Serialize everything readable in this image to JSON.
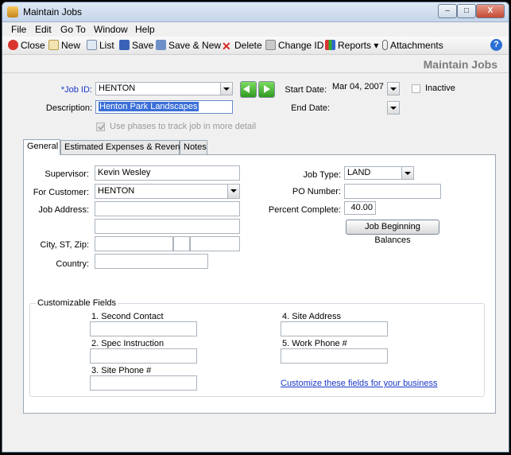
{
  "window": {
    "title": "Maintain Jobs",
    "minimize": "–",
    "maximize": "□",
    "close": "X"
  },
  "menu": [
    "File",
    "Edit",
    "Go To",
    "Window",
    "Help"
  ],
  "toolbar": {
    "close": "Close",
    "new": "New",
    "list": "List",
    "save": "Save",
    "save_new": "Save & New",
    "delete": "Delete",
    "change_id": "Change ID",
    "reports": "Reports ▾",
    "attachments": "Attachments",
    "help": "?"
  },
  "header": {
    "title": "Maintain Jobs"
  },
  "form": {
    "job_id_label": "*Job ID:",
    "job_id": "HENTON",
    "description_label": "Description:",
    "description": "Henton Park Landscapes",
    "start_date_label": "Start Date:",
    "start_date": "Mar 04, 2007",
    "end_date_label": "End Date:",
    "end_date": "",
    "inactive_label": "Inactive",
    "phases_label": "Use phases to track job in more detail"
  },
  "tabs": [
    "General",
    "Estimated Expenses & Revenue",
    "Notes"
  ],
  "general": {
    "supervisor_label": "Supervisor:",
    "supervisor": "Kevin Wesley",
    "customer_label": "For Customer:",
    "customer": "HENTON",
    "address_label": "Job Address:",
    "address1": "",
    "address2": "",
    "city_label": "City, ST, Zip:",
    "city": "",
    "state": "",
    "zip": "",
    "country_label": "Country:",
    "country": "",
    "job_type_label": "Job Type:",
    "job_type": "LAND",
    "po_label": "PO Number:",
    "po": "",
    "percent_label": "Percent Complete:",
    "percent": "40.00",
    "beginning_balances": "Job Beginning Balances"
  },
  "custom": {
    "title": "Customizable Fields",
    "f1": "1. Second Contact",
    "f2": "2. Spec Instruction",
    "f3": "3. Site Phone #",
    "f4": "4. Site Address",
    "f5": "5. Work Phone #",
    "link": "Customize these fields for your business"
  }
}
